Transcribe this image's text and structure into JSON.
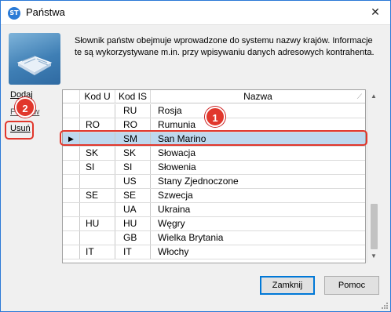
{
  "window": {
    "title": "Państwa",
    "app_icon_text": "ST",
    "close_glyph": "✕"
  },
  "info": {
    "line1": "Słownik państw obejmuje wprowadzone do systemu nazwy krajów. Informacje",
    "line2": "te są wykorzystywane m.in. przy wpisywaniu danych adresowych kontrahenta."
  },
  "actions": {
    "add": "Dodaj",
    "edit": "Popraw",
    "delete": "Usuń"
  },
  "grid": {
    "columns": [
      "",
      "Kod U",
      "Kod IS",
      "Nazwa"
    ],
    "rows": [
      {
        "kod_u": "",
        "kod_is": "RU",
        "nazwa": "Rosja"
      },
      {
        "kod_u": "RO",
        "kod_is": "RO",
        "nazwa": "Rumunia"
      },
      {
        "kod_u": "",
        "kod_is": "SM",
        "nazwa": "San Marino",
        "selected": true
      },
      {
        "kod_u": "SK",
        "kod_is": "SK",
        "nazwa": "Słowacja"
      },
      {
        "kod_u": "SI",
        "kod_is": "SI",
        "nazwa": "Słowenia"
      },
      {
        "kod_u": "",
        "kod_is": "US",
        "nazwa": "Stany Zjednoczone"
      },
      {
        "kod_u": "SE",
        "kod_is": "SE",
        "nazwa": "Szwecja"
      },
      {
        "kod_u": "",
        "kod_is": "UA",
        "nazwa": "Ukraina"
      },
      {
        "kod_u": "HU",
        "kod_is": "HU",
        "nazwa": "Węgry"
      },
      {
        "kod_u": "",
        "kod_is": "GB",
        "nazwa": "Wielka Brytania"
      },
      {
        "kod_u": "IT",
        "kod_is": "IT",
        "nazwa": "Włochy"
      }
    ],
    "selected_indicator": "▶"
  },
  "callouts": {
    "one": "1",
    "two": "2"
  },
  "buttons": {
    "close": "Zamknij",
    "help": "Pomoc"
  },
  "colors": {
    "selection": "#bed8ee",
    "callout": "#e1372c",
    "window_border": "#2b79d6"
  }
}
